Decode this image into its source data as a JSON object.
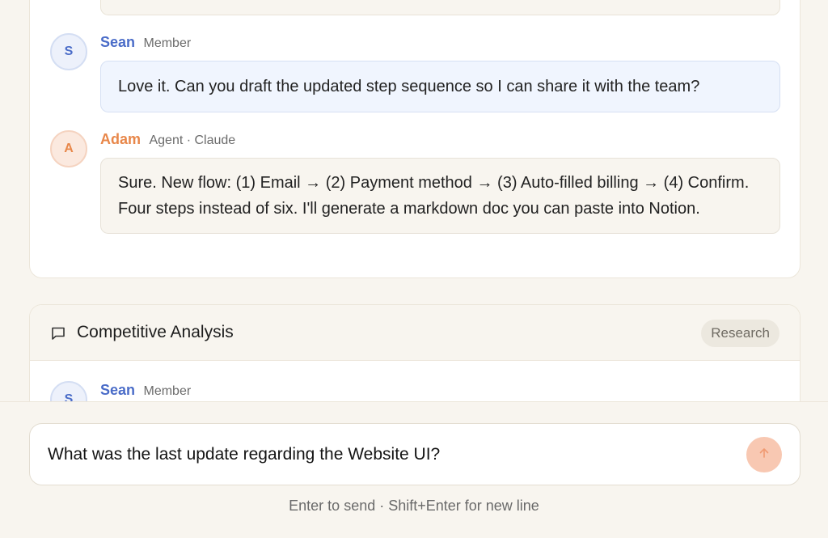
{
  "threads": [
    {
      "messages": [
        {
          "author": "Sean",
          "role": "Member",
          "initial": "S",
          "text": "Love it. Can you draft the updated step sequence so I can share it with the team?"
        },
        {
          "author": "Adam",
          "role": "Agent · Claude",
          "initial": "A",
          "text": "Sure. New flow: (1) Email → (2) Payment method → (3) Auto-filled billing → (4) Confirm. Four steps instead of six. I'll generate a markdown doc you can paste into Notion."
        }
      ]
    },
    {
      "title": "Competitive Analysis",
      "tag": "Research",
      "messages": [
        {
          "author": "Sean",
          "role": "Member",
          "initial": "S"
        }
      ]
    }
  ],
  "composer": {
    "value": "What was the last update regarding the Website UI?",
    "hint": "Enter to send · Shift+Enter for new line",
    "send_icon": "arrow-up-icon"
  },
  "colors": {
    "user_accent": "#4a6cc8",
    "agent_accent": "#e8874a",
    "send_button": "#f8c8b2"
  }
}
